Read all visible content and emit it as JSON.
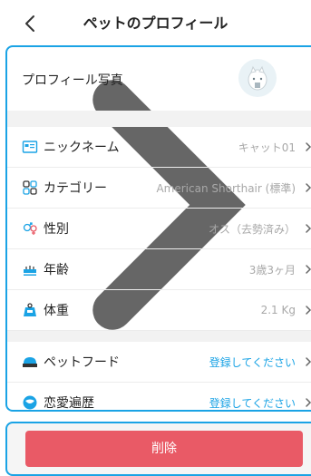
{
  "header": {
    "title": "ペットのプロフィール",
    "back_icon": "chevron-left-icon"
  },
  "profile": {
    "photo_label": "プロフィール写真",
    "items": [
      {
        "label": "ニックネーム",
        "value": "キャット01",
        "icon": "id-card-icon"
      },
      {
        "label": "カテゴリー",
        "value": "American Shorthair (標準)",
        "icon": "grid-icon"
      },
      {
        "label": "性別",
        "value": "オス（去勢済み）",
        "icon": "gender-icon"
      },
      {
        "label": "年齢",
        "value": "3歳3ヶ月",
        "icon": "cake-icon"
      },
      {
        "label": "体重",
        "value": "2.1 Kg",
        "icon": "weight-icon"
      }
    ],
    "extra_items": [
      {
        "label": "ペットフード",
        "value": "登録してください",
        "icon": "food-bowl-icon"
      },
      {
        "label": "恋愛遍歴",
        "value": "登録してください",
        "icon": "heart-history-icon"
      }
    ]
  },
  "actions": {
    "delete_label": "削除"
  },
  "colors": {
    "accent": "#1aa3e5",
    "danger": "#e95a66"
  }
}
